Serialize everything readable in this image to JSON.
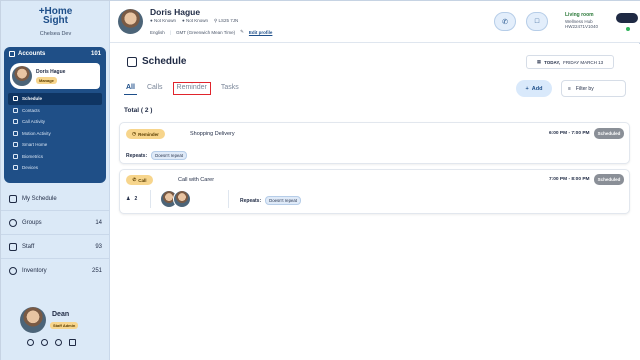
{
  "app": {
    "logo_line1": "+Home",
    "logo_line2": "Sight",
    "org": "Chelsea Dev"
  },
  "sidebar": {
    "accounts_label": "Accounts",
    "accounts_count": "101",
    "user_card": {
      "name": "Doris Hague",
      "badge": "Manage"
    },
    "menu": [
      {
        "label": "Schedule",
        "active": true,
        "icon": "calendar-icon"
      },
      {
        "label": "Contacts",
        "icon": "contacts-icon"
      },
      {
        "label": "Call Activity",
        "icon": "phone-icon"
      },
      {
        "label": "Motion Activity",
        "icon": "motion-icon"
      },
      {
        "label": "Smart Home",
        "icon": "home-icon"
      },
      {
        "label": "Biometrics",
        "icon": "heart-icon"
      },
      {
        "label": "Devices",
        "icon": "devices-icon"
      }
    ],
    "nav": [
      {
        "label": "My Schedule",
        "count": "",
        "icon": "calendar-icon"
      },
      {
        "label": "Groups",
        "count": "14",
        "icon": "groups-icon"
      },
      {
        "label": "Staff",
        "count": "93",
        "icon": "staff-icon"
      },
      {
        "label": "Inventory",
        "count": "251",
        "icon": "inventory-icon"
      }
    ],
    "current_user": {
      "name": "Dean",
      "role": "Staff Admin"
    }
  },
  "header": {
    "patient_name": "Doris Hague",
    "meta1": "Not Known",
    "meta2": "Not Known",
    "postcode": "LS25 7JN",
    "language": "English",
    "timezone": "GMT (Greenwich Mean Time)",
    "edit_label": "Edit profile",
    "room_name": "Living room",
    "hub": "Wellness Hub",
    "hub_id": "HW22471V1040"
  },
  "main": {
    "title": "Schedule",
    "date_label": "TODAY,",
    "date_value": "FRIDAY MARCH 13",
    "tabs": [
      "All",
      "Calls",
      "Reminder",
      "Tasks"
    ],
    "add_label": "Add",
    "filter_label": "Filter by",
    "total_label": "Total ( 2 )",
    "cards": [
      {
        "type": "Reminder",
        "title": "Shopping Delivery",
        "time": "6:00 PM - 7:00 PM",
        "status": "Scheduled",
        "repeats_label": "Repeats:",
        "repeats_value": "Doesn't repeat"
      },
      {
        "type": "Call",
        "title": "Call with Carer",
        "time": "7:00 PM - 8:00 PM",
        "status": "Scheduled",
        "participants": "2",
        "repeats_label": "Repeats:",
        "repeats_value": "Doesn't repeat"
      }
    ]
  },
  "colors": {
    "primary": "#1f4f87",
    "accent_yellow": "#f7d58c",
    "sidebar_bg": "#dbe9f7",
    "highlight_red": "#e0242c",
    "status_grey": "#8a8f97"
  }
}
